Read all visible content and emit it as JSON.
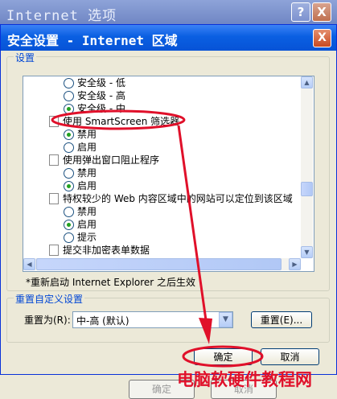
{
  "background_window": {
    "title": "Internet 选项",
    "help_button": "?",
    "close_button": "X",
    "bottom_buttons": [
      "确定",
      "取消"
    ]
  },
  "dialog": {
    "title": "安全设置 - Internet 区域",
    "close_button": "X",
    "settings_group_label": "设置",
    "tree_rows": [
      {
        "type": "radio",
        "checked": false,
        "text": "安全级 - 低"
      },
      {
        "type": "radio",
        "checked": false,
        "text": "安全级 - 高"
      },
      {
        "type": "radio",
        "checked": true,
        "text": "安全级 - 中"
      },
      {
        "type": "doc",
        "text": "使用 SmartScreen 筛选器"
      },
      {
        "type": "radio",
        "checked": true,
        "text": "禁用"
      },
      {
        "type": "radio",
        "checked": false,
        "text": "启用"
      },
      {
        "type": "doc",
        "text": "使用弹出窗口阻止程序"
      },
      {
        "type": "radio",
        "checked": false,
        "text": "禁用"
      },
      {
        "type": "radio",
        "checked": true,
        "text": "启用"
      },
      {
        "type": "doc",
        "text": "特权较少的 Web 内容区域中的网站可以定位到该区域"
      },
      {
        "type": "radio",
        "checked": false,
        "text": "禁用"
      },
      {
        "type": "radio",
        "checked": true,
        "text": "启用"
      },
      {
        "type": "radio",
        "checked": false,
        "text": "提示"
      },
      {
        "type": "doc",
        "text": "提交非加密表单数据"
      }
    ],
    "restart_note": "*重新启动 Internet Explorer 之后生效",
    "reset_group_label": "重置自定义设置",
    "reset_to_label": "重置为(R):",
    "reset_select_value": "中-高 (默认)",
    "reset_button": "重置(E)...",
    "ok_button": "确定",
    "cancel_button": "取消"
  },
  "watermark": "电脑软硬件教程网",
  "colors": {
    "title_bar": "#0a5fe2",
    "annotation_red": "#e0102a",
    "radio_checked": "#21a121",
    "group_label": "#0046d5"
  }
}
